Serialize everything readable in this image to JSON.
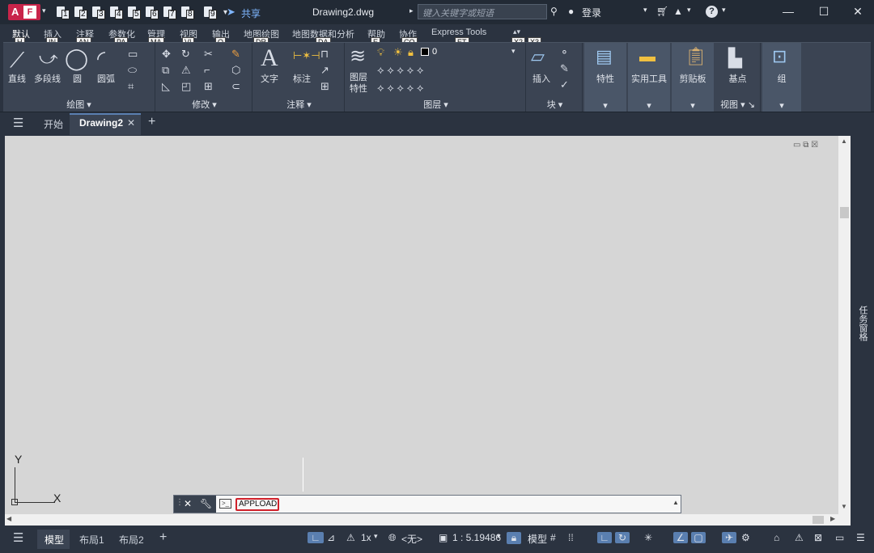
{
  "app": {
    "logo_a": "A",
    "logo_f": "F",
    "document_title": "Drawing2.dwg",
    "share_label": "共享",
    "search_placeholder": "键入关键字或短语",
    "login_label": "登录"
  },
  "qat_numbers": [
    "1",
    "2",
    "3",
    "4",
    "5",
    "6",
    "7",
    "8",
    "9"
  ],
  "menu_tabs": [
    "默认",
    "插入",
    "注释",
    "参数化",
    "管理",
    "视图",
    "输出",
    "地图绘图",
    "地图数据和分析",
    "帮助",
    "协作",
    "Express Tools"
  ],
  "keytips": {
    "h": "H",
    "in": "IN",
    "an": "AN",
    "pa": "PA",
    "ma": "MA",
    "vi": "VI",
    "o": "O",
    "dr": "DR",
    "da": "DA",
    "e": "E",
    "co": "CO",
    "et": "ET",
    "x2": "X2",
    "x3": "X3"
  },
  "ribbon": {
    "draw": {
      "line": "直线",
      "polyline": "多段线",
      "circle": "圆",
      "arc": "圆弧",
      "panel": "绘图"
    },
    "modify": {
      "panel": "修改"
    },
    "annotation": {
      "text": "文字",
      "dimension": "标注",
      "panel": "注释"
    },
    "layers": {
      "properties": "图层\n特性",
      "current": "0",
      "panel": "图层"
    },
    "block": {
      "insert": "插入",
      "panel": "块"
    },
    "properties": "特性",
    "utilities": "实用工具",
    "clipboard": "剪贴板",
    "base": "基点",
    "view_panel": "视图",
    "groups": "组"
  },
  "file_tabs": {
    "start": "开始",
    "drawing": "Drawing2"
  },
  "taskpal_label": "任务窗格",
  "ucs": {
    "x": "X",
    "y": "Y"
  },
  "command": {
    "value": "APPLOAD"
  },
  "status": {
    "model": "模型",
    "layout1": "布局1",
    "layout2": "布局2",
    "scale_x": "1x",
    "annot": "<无>",
    "ratio": "1 : 5.19486",
    "model_btn": "模型"
  }
}
